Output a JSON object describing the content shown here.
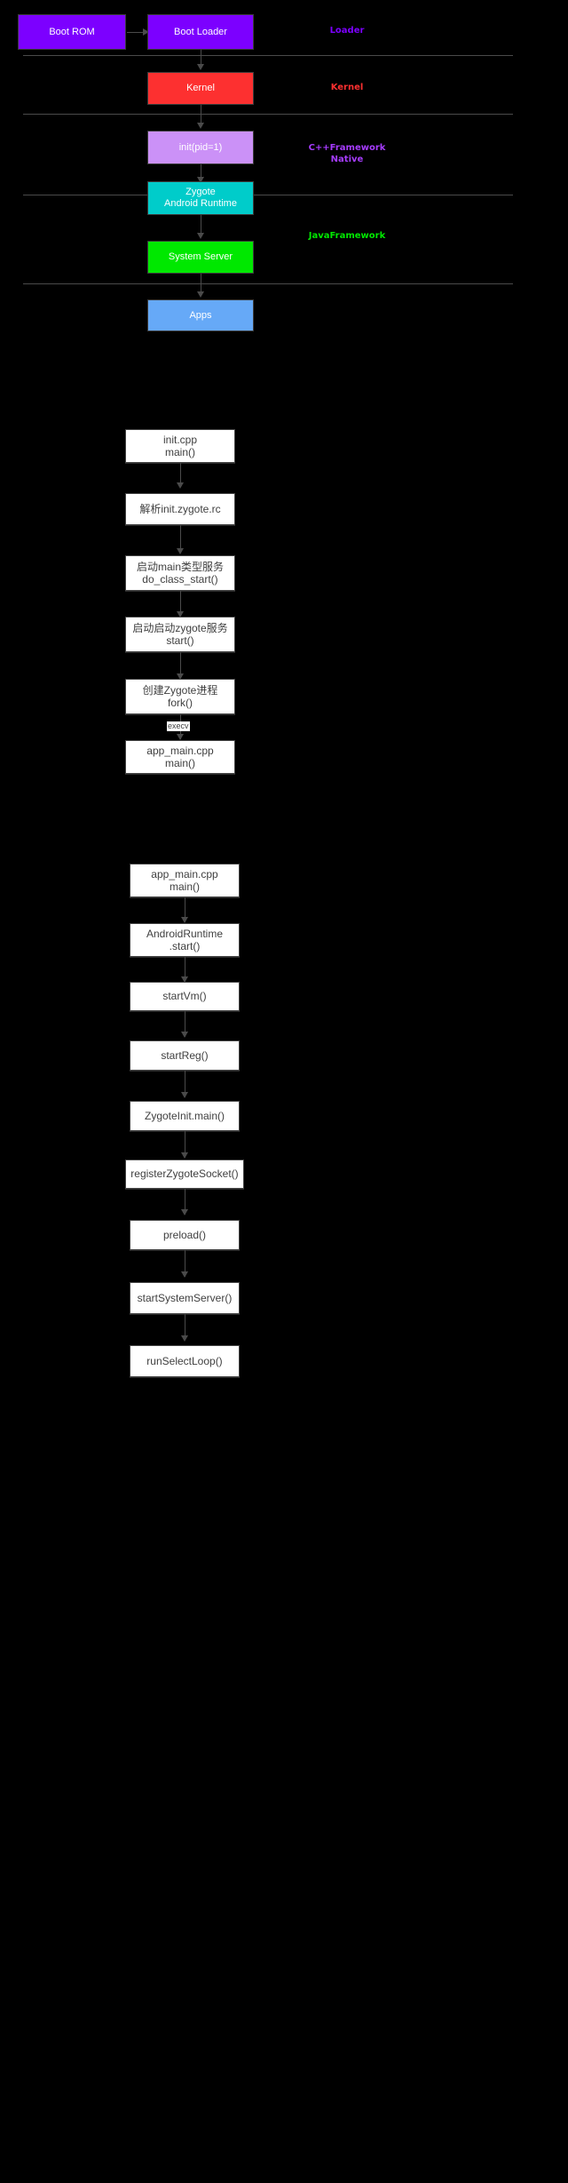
{
  "diagrams": [
    {
      "id": "android-boot-layers",
      "nodes": [
        {
          "id": "boot-rom",
          "label": "Boot ROM",
          "color": "#7c00ff"
        },
        {
          "id": "boot-loader",
          "label": "Boot Loader",
          "color": "#7c00ff"
        },
        {
          "id": "kernel",
          "label": "Kernel",
          "color": "#fd3030"
        },
        {
          "id": "init",
          "label": "init(pid=1)",
          "color": "#cb91f7"
        },
        {
          "id": "zygote",
          "label": "Zygote\nAndroid Runtime",
          "color": "#00ccca"
        },
        {
          "id": "system-server",
          "label": "System Server",
          "color": "#00e800"
        },
        {
          "id": "apps",
          "label": "Apps",
          "color": "#66a9f7"
        }
      ],
      "captions": [
        {
          "id": "caption-loader",
          "label": "Loader",
          "color": "#7c00ff"
        },
        {
          "id": "caption-kernel",
          "label": "Kernel",
          "color": "#fd3030"
        },
        {
          "id": "caption-native",
          "label": "C++Framework\nNative",
          "color": "#a63cff"
        },
        {
          "id": "caption-java",
          "label": "JavaFramework",
          "color": "#00e800"
        }
      ]
    },
    {
      "id": "init-zygote-flow",
      "nodes": [
        {
          "id": "init-cpp-main",
          "label": "init.cpp\nmain()"
        },
        {
          "id": "parse-rc",
          "label": "解析init.zygote.rc"
        },
        {
          "id": "do-class-start",
          "label": "启动main类型服务\ndo_class_start()"
        },
        {
          "id": "start-zygote",
          "label": "启动启动zygote服务\nstart()"
        },
        {
          "id": "fork-zygote",
          "label": "创建Zygote进程\nfork()"
        },
        {
          "id": "app-main-cpp",
          "label": "app_main.cpp\nmain()"
        }
      ],
      "edge_labels": [
        {
          "id": "execv-label",
          "label": "execv"
        }
      ]
    },
    {
      "id": "zygote-startup-flow",
      "nodes": [
        {
          "id": "app-main-cpp-2",
          "label": "app_main.cpp\nmain()"
        },
        {
          "id": "android-runtime-start",
          "label": "AndroidRuntime\n.start()"
        },
        {
          "id": "start-vm",
          "label": "startVm()"
        },
        {
          "id": "start-reg",
          "label": "startReg()"
        },
        {
          "id": "zygote-init-main",
          "label": "ZygoteInit.main()"
        },
        {
          "id": "register-zygote-socket",
          "label": "registerZygoteSocket()"
        },
        {
          "id": "preload",
          "label": "preload()"
        },
        {
          "id": "start-system-server",
          "label": "startSystemServer()"
        },
        {
          "id": "run-select-loop",
          "label": "runSelectLoop()"
        }
      ]
    }
  ]
}
